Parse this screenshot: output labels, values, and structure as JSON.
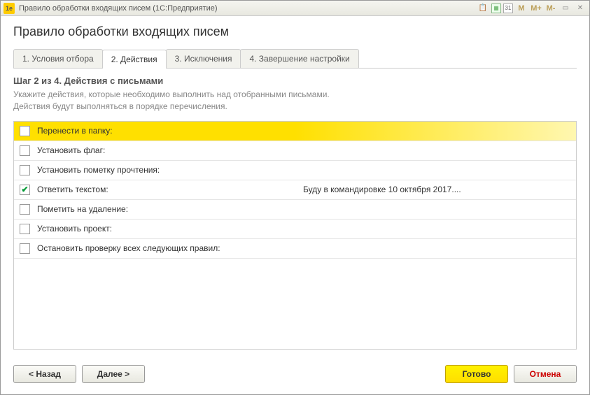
{
  "titlebar": {
    "icon_text": "1e",
    "title": "Правило обработки входящих писем  (1С:Предприятие)",
    "m": "M",
    "m_plus": "M+",
    "m_minus": "M-",
    "cal_num": "31"
  },
  "page_title": "Правило обработки входящих писем",
  "tabs": {
    "t1": "1. Условия отбора",
    "t2": "2. Действия",
    "t3": "3. Исключения",
    "t4": "4. Завершение настройки"
  },
  "step": {
    "title": "Шаг 2 из 4. Действия с письмами",
    "desc_line1": "Укажите действия, которые необходимо выполнить над отобранными письмами.",
    "desc_line2": "Действия будут выполняться в порядке перечисления."
  },
  "rows": {
    "r0": {
      "label": "Перенести в папку:",
      "value": "",
      "checked": ""
    },
    "r1": {
      "label": "Установить флаг:",
      "value": "",
      "checked": ""
    },
    "r2": {
      "label": "Установить пометку прочтения:",
      "value": "",
      "checked": ""
    },
    "r3": {
      "label": "Ответить текстом:",
      "value": "Буду в командировке 10 октября 2017....",
      "checked": "✔"
    },
    "r4": {
      "label": "Пометить на удаление:",
      "value": "",
      "checked": ""
    },
    "r5": {
      "label": "Установить проект:",
      "value": "",
      "checked": ""
    },
    "r6": {
      "label": "Остановить проверку всех следующих правил:",
      "value": "",
      "checked": ""
    }
  },
  "buttons": {
    "back": "< Назад",
    "next": "Далее >",
    "finish": "Готово",
    "cancel": "Отмена"
  }
}
